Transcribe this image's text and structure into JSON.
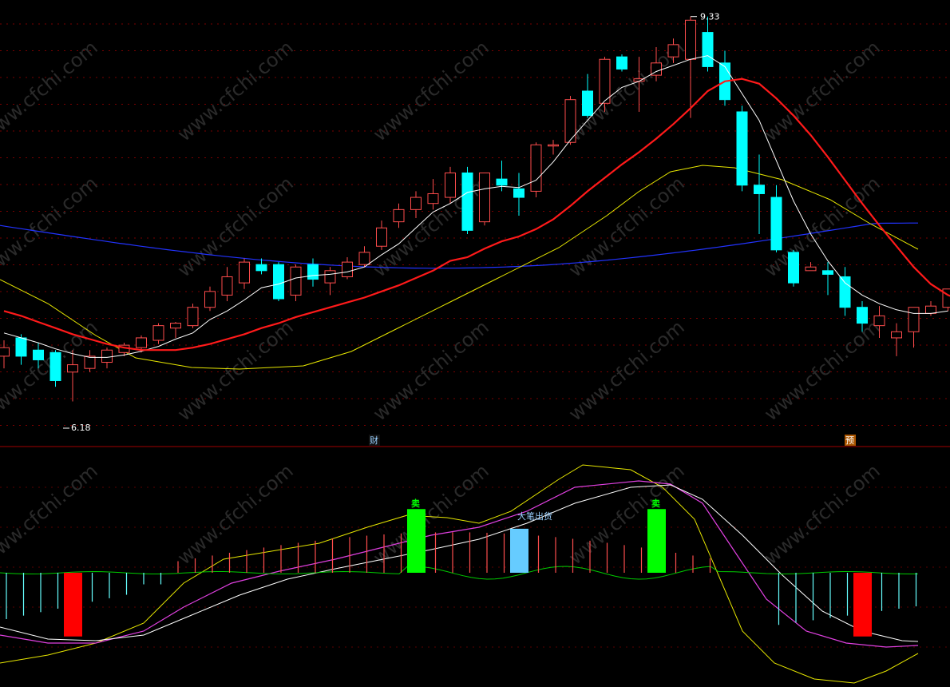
{
  "chart_data": [
    {
      "type": "candlestick",
      "annotations": {
        "high_label": "9.33",
        "low_label": "6.18",
        "event_caicai": "财",
        "event_yu": "预"
      },
      "colors": {
        "background": "#000000",
        "up_candle": "#ff4d4d",
        "down_candle": "#00ffff",
        "ma_short": "#ffffff",
        "ma_mid": "#ff1a1a",
        "ma_long": "#e6e600",
        "ma_longest": "#2233ff",
        "grid": "#7a0000"
      },
      "grid": true,
      "ylim": [
        6.0,
        9.4
      ],
      "candles": [
        [
          6.55,
          6.68,
          6.45,
          6.62
        ],
        [
          6.7,
          6.73,
          6.48,
          6.55
        ],
        [
          6.6,
          6.66,
          6.45,
          6.52
        ],
        [
          6.58,
          6.6,
          6.3,
          6.35
        ],
        [
          6.42,
          6.6,
          6.18,
          6.48
        ],
        [
          6.45,
          6.6,
          6.42,
          6.55
        ],
        [
          6.5,
          6.62,
          6.45,
          6.6
        ],
        [
          6.58,
          6.66,
          6.55,
          6.64
        ],
        [
          6.62,
          6.72,
          6.58,
          6.7
        ],
        [
          6.68,
          6.82,
          6.65,
          6.8
        ],
        [
          6.78,
          6.83,
          6.7,
          6.82
        ],
        [
          6.8,
          6.98,
          6.78,
          6.95
        ],
        [
          6.95,
          7.12,
          6.92,
          7.08
        ],
        [
          7.05,
          7.28,
          7.0,
          7.2
        ],
        [
          7.15,
          7.35,
          7.1,
          7.32
        ],
        [
          7.3,
          7.35,
          7.22,
          7.25
        ],
        [
          7.3,
          7.32,
          7.0,
          7.02
        ],
        [
          7.05,
          7.3,
          7.0,
          7.28
        ],
        [
          7.3,
          7.35,
          7.12,
          7.18
        ],
        [
          7.15,
          7.28,
          7.05,
          7.25
        ],
        [
          7.2,
          7.36,
          7.18,
          7.32
        ],
        [
          7.3,
          7.45,
          7.28,
          7.4
        ],
        [
          7.45,
          7.66,
          7.42,
          7.6
        ],
        [
          7.65,
          7.8,
          7.6,
          7.75
        ],
        [
          7.75,
          7.9,
          7.68,
          7.85
        ],
        [
          7.8,
          8.0,
          7.75,
          7.88
        ],
        [
          7.85,
          8.1,
          7.8,
          8.05
        ],
        [
          8.05,
          8.1,
          7.55,
          7.58
        ],
        [
          7.65,
          8.05,
          7.62,
          8.05
        ],
        [
          8.0,
          8.15,
          7.9,
          7.95
        ],
        [
          7.92,
          8.05,
          7.7,
          7.85
        ],
        [
          7.9,
          8.3,
          7.85,
          8.28
        ],
        [
          8.28,
          8.32,
          8.2,
          8.28
        ],
        [
          8.3,
          8.68,
          8.28,
          8.65
        ],
        [
          8.72,
          8.86,
          8.5,
          8.52
        ],
        [
          8.62,
          9.0,
          8.55,
          8.98
        ],
        [
          9.0,
          9.02,
          8.88,
          8.9
        ],
        [
          8.8,
          9.0,
          8.55,
          8.82
        ],
        [
          8.85,
          9.08,
          8.8,
          8.95
        ],
        [
          9.0,
          9.15,
          8.95,
          9.1
        ],
        [
          8.98,
          9.33,
          8.5,
          9.3
        ],
        [
          9.2,
          9.33,
          8.88,
          8.92
        ],
        [
          8.95,
          9.05,
          8.6,
          8.65
        ],
        [
          8.55,
          8.6,
          7.9,
          7.95
        ],
        [
          7.95,
          8.2,
          7.55,
          7.88
        ],
        [
          7.85,
          7.95,
          7.4,
          7.42
        ],
        [
          7.4,
          7.42,
          7.12,
          7.15
        ],
        [
          7.25,
          7.32,
          7.25,
          7.28
        ],
        [
          7.25,
          7.32,
          7.05,
          7.22
        ],
        [
          7.2,
          7.28,
          6.88,
          6.95
        ],
        [
          6.95,
          7.0,
          6.75,
          6.82
        ],
        [
          6.8,
          6.96,
          6.7,
          6.88
        ],
        [
          6.7,
          6.82,
          6.55,
          6.75
        ],
        [
          6.75,
          6.95,
          6.62,
          6.95
        ],
        [
          6.9,
          7.0,
          6.88,
          6.96
        ],
        [
          6.95,
          7.1,
          6.92,
          7.1
        ]
      ],
      "ma_short": [
        6.74,
        6.7,
        6.66,
        6.61,
        6.57,
        6.54,
        6.54,
        6.56,
        6.59,
        6.63,
        6.69,
        6.74,
        6.85,
        6.92,
        7.01,
        7.11,
        7.14,
        7.19,
        7.21,
        7.22,
        7.24,
        7.28,
        7.38,
        7.47,
        7.6,
        7.73,
        7.8,
        7.89,
        7.92,
        7.94,
        7.93,
        7.99,
        8.14,
        8.32,
        8.48,
        8.64,
        8.75,
        8.8,
        8.88,
        8.93,
        8.98,
        9.01,
        8.92,
        8.7,
        8.48,
        8.15,
        7.82,
        7.55,
        7.33,
        7.15,
        7.05,
        6.98,
        6.93,
        6.9,
        6.9,
        6.92
      ],
      "ma_mid": [
        6.92,
        6.88,
        6.83,
        6.78,
        6.73,
        6.69,
        6.65,
        6.62,
        6.6,
        6.6,
        6.6,
        6.62,
        6.65,
        6.69,
        6.73,
        6.78,
        6.82,
        6.87,
        6.91,
        6.95,
        6.99,
        7.03,
        7.08,
        7.13,
        7.19,
        7.25,
        7.33,
        7.36,
        7.43,
        7.49,
        7.53,
        7.59,
        7.67,
        7.78,
        7.9,
        8.01,
        8.12,
        8.22,
        8.33,
        8.45,
        8.58,
        8.72,
        8.8,
        8.82,
        8.78,
        8.66,
        8.52,
        8.36,
        8.18,
        7.99,
        7.8,
        7.62,
        7.45,
        7.28,
        7.14,
        7.05,
        7.0,
        6.99
      ]
    },
    {
      "type": "indicator",
      "annotations": {
        "sell_label": "卖",
        "big_sell_label": "大笔出货"
      },
      "colors": {
        "zero_line": "#00cc00",
        "pos_bar": "#ff4d4d",
        "neg_bar": "#66ffff",
        "signal_red": "#ff0000",
        "signal_green": "#00ff00",
        "signal_blue": "#66ccff",
        "line_yellow": "#e6e600",
        "line_magenta": "#e040e0",
        "line_white": "#ffffff"
      },
      "ylim": [
        -100,
        100
      ],
      "signals": [
        {
          "kind": "buy",
          "index": 4,
          "value": -55
        },
        {
          "kind": "sell",
          "index": 24,
          "value": 55
        },
        {
          "kind": "big_sell",
          "index": 30,
          "value": 38
        },
        {
          "kind": "sell",
          "index": 38,
          "value": 55
        },
        {
          "kind": "buy",
          "index": 50,
          "value": -55
        }
      ]
    }
  ]
}
